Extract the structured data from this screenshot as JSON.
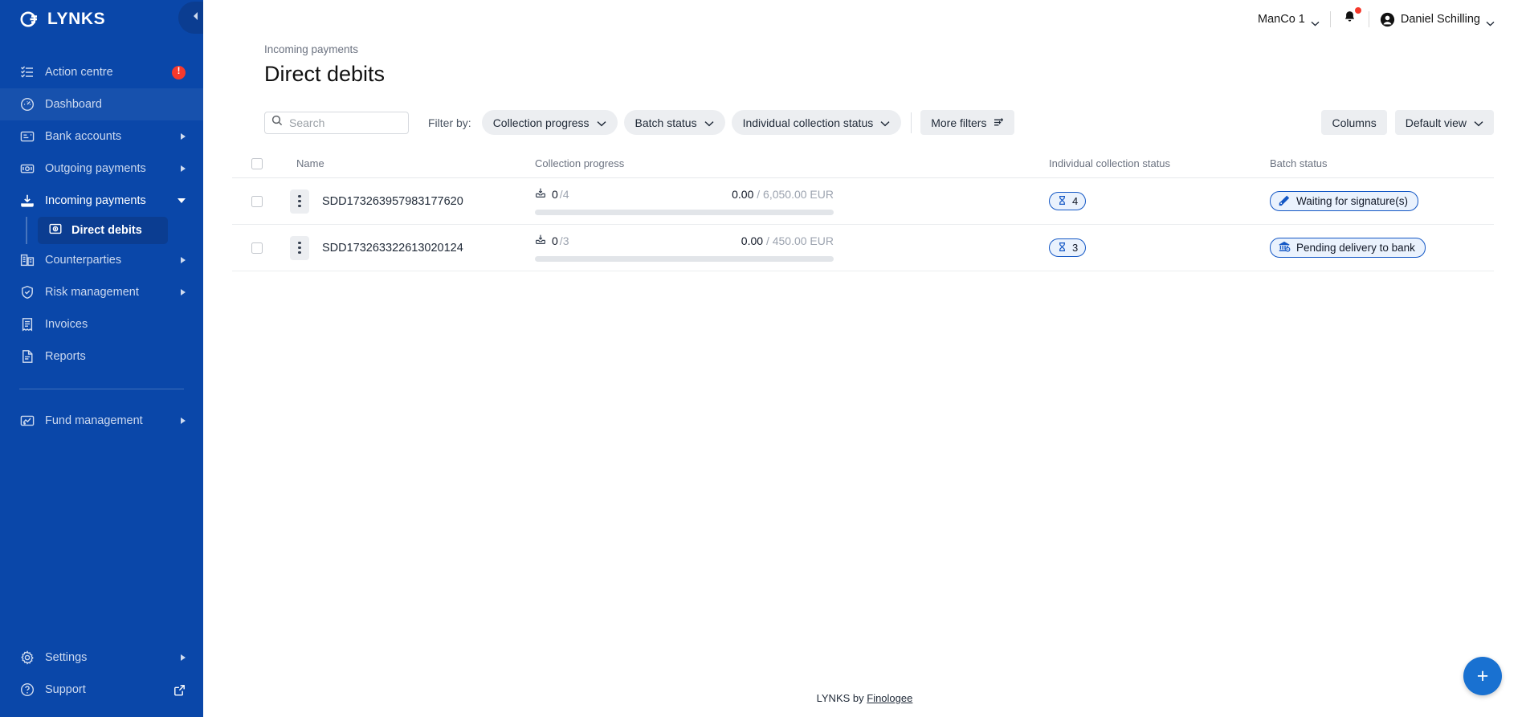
{
  "brand": {
    "name": "LYNKS",
    "logo_icon": "lynks-logo-icon",
    "collapse_icon": "chevron-left-icon"
  },
  "sidebar": {
    "items": [
      {
        "label": "Action centre",
        "icon": "action-list-icon",
        "badge": "!",
        "state": "default"
      },
      {
        "label": "Dashboard",
        "icon": "speedometer-icon",
        "state": "hover"
      },
      {
        "label": "Bank accounts",
        "icon": "bank-card-icon",
        "expandable": true
      },
      {
        "label": "Outgoing payments",
        "icon": "banknote-icon",
        "expandable": true
      },
      {
        "label": "Incoming payments",
        "icon": "download-tray-icon",
        "expanded": true
      },
      {
        "label": "Counterparties",
        "icon": "buildings-icon",
        "expandable": true
      },
      {
        "label": "Risk management",
        "icon": "shield-check-icon",
        "expandable": true
      },
      {
        "label": "Invoices",
        "icon": "receipt-icon"
      },
      {
        "label": "Reports",
        "icon": "document-icon"
      }
    ],
    "sub_item": {
      "label": "Direct debits",
      "icon": "direct-debit-icon"
    },
    "group2": [
      {
        "label": "Fund management",
        "icon": "fund-chart-icon",
        "expandable": true
      }
    ],
    "bottom": [
      {
        "label": "Settings",
        "icon": "gear-icon",
        "expandable": true
      },
      {
        "label": "Support",
        "icon": "question-circle-icon",
        "external": true
      }
    ]
  },
  "topbar": {
    "org": "ManCo 1",
    "org_chevron": "chevron-down-icon",
    "notifications_icon": "bell-icon",
    "has_notification": true,
    "user_icon": "user-avatar-icon",
    "user": "Daniel Schilling",
    "user_chevron": "chevron-down-icon"
  },
  "page": {
    "breadcrumb": "Incoming payments",
    "title": "Direct debits"
  },
  "toolbar": {
    "search_placeholder": "Search",
    "search_value": "",
    "search_icon": "search-icon",
    "filter_by_label": "Filter by:",
    "filters": [
      {
        "label": "Collection progress",
        "icon": "chevron-down-icon"
      },
      {
        "label": "Batch status",
        "icon": "chevron-down-icon"
      },
      {
        "label": "Individual collection status",
        "icon": "chevron-down-icon"
      }
    ],
    "more_filters": {
      "label": "More filters",
      "icon": "filter-sliders-icon"
    },
    "columns": {
      "label": "Columns"
    },
    "view": {
      "label": "Default view",
      "icon": "chevron-down-icon"
    }
  },
  "table": {
    "headers": {
      "name": "Name",
      "collection_progress": "Collection progress",
      "individual_collection_status": "Individual collection status",
      "batch_status": "Batch status"
    },
    "rows": [
      {
        "name": "SDD173263957983177620",
        "progress_count_done": "0",
        "progress_count_sep": "/",
        "progress_count_total": "4",
        "progress_icon": "collection-inbox-icon",
        "amount_paid": "0.00",
        "amount_sep": "/",
        "amount_total": "6,050.00 EUR",
        "progress_percent": 0,
        "individual_status_count": "4",
        "individual_status_icon": "hourglass-icon",
        "batch_status": "Waiting for signature(s)",
        "batch_status_icon": "signature-pen-icon"
      },
      {
        "name": "SDD173263322613020124",
        "progress_count_done": "0",
        "progress_count_sep": "/",
        "progress_count_total": "3",
        "progress_icon": "collection-inbox-icon",
        "amount_paid": "0.00",
        "amount_sep": "/",
        "amount_total": "450.00 EUR",
        "progress_percent": 0,
        "individual_status_count": "3",
        "individual_status_icon": "hourglass-icon",
        "batch_status": "Pending delivery to bank",
        "batch_status_icon": "bank-clock-icon"
      }
    ]
  },
  "footer": {
    "prefix": "LYNKS by ",
    "link": "Finologee"
  },
  "fab": {
    "label": "+",
    "icon": "plus-icon"
  },
  "colors": {
    "sidebar": "#0a47a9",
    "sidebar_active": "#0b3d91",
    "accent": "#1357c5",
    "fab": "#1971d1",
    "badge_red": "#f5392c",
    "chip_bg": "#eaf2fd",
    "pill_bg": "#eceef1"
  }
}
